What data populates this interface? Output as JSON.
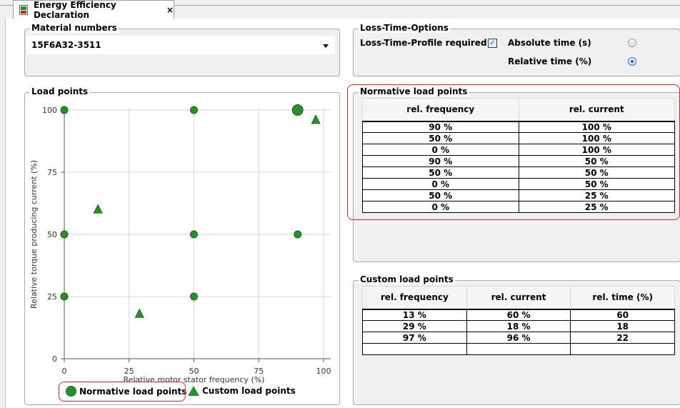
{
  "tab": {
    "title": "Energy Efficiency Declaration",
    "close": "×"
  },
  "material": {
    "title": "Material numbers",
    "value": "15F6A32-3511"
  },
  "loss_time": {
    "title": "Loss-Time-Options",
    "profile_label": "Loss-Time-Profile required",
    "profile_checked": true,
    "absolute_label": "Absolute time (s)",
    "relative_label": "Relative time (%)",
    "selected": "relative"
  },
  "load_points": {
    "title": "Load points",
    "legend_normative": "Normative load points",
    "legend_custom": "Custom load points"
  },
  "normative": {
    "title": "Normative load points",
    "headers": [
      "rel. frequency",
      "rel. current"
    ],
    "rows": [
      [
        "90 %",
        "100 %"
      ],
      [
        "50 %",
        "100 %"
      ],
      [
        "0 %",
        "100 %"
      ],
      [
        "90 %",
        "50 %"
      ],
      [
        "50 %",
        "50 %"
      ],
      [
        "0 %",
        "50 %"
      ],
      [
        "50 %",
        "25 %"
      ],
      [
        "0 %",
        "25 %"
      ]
    ]
  },
  "custom": {
    "title": "Custom load points",
    "headers": [
      "rel. frequency",
      "rel. current",
      "rel. time (%)"
    ],
    "rows": [
      [
        "13 %",
        "60 %",
        "60"
      ],
      [
        "29 %",
        "18 %",
        "18"
      ],
      [
        "97 %",
        "96 %",
        "22"
      ],
      [
        "",
        "",
        ""
      ]
    ]
  },
  "chart_data": {
    "type": "scatter",
    "xlabel": "Relative motor stator frequency (%)",
    "ylabel": "Relative torque producing current (%)",
    "xlim": [
      0,
      100
    ],
    "ylim": [
      0,
      100
    ],
    "xticks": [
      "0",
      "25",
      "50",
      "75",
      "100"
    ],
    "yticks": [
      "0",
      "25",
      "50",
      "75",
      "100"
    ],
    "grid": true,
    "marker_color": "#2a8f2a",
    "series": [
      {
        "name": "Normative load points",
        "marker": "circle",
        "points": [
          [
            90,
            100
          ],
          [
            50,
            100
          ],
          [
            0,
            100
          ],
          [
            90,
            50
          ],
          [
            50,
            50
          ],
          [
            0,
            50
          ],
          [
            50,
            25
          ],
          [
            0,
            25
          ]
        ]
      },
      {
        "name": "Custom load points",
        "marker": "triangle",
        "points": [
          [
            13,
            60
          ],
          [
            29,
            18
          ],
          [
            97,
            96
          ]
        ]
      }
    ]
  }
}
